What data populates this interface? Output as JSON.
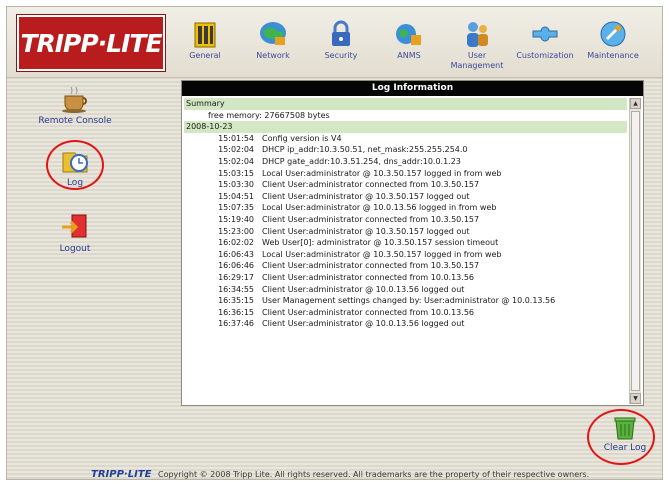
{
  "logo": {
    "text": "TRIPP·LITE"
  },
  "nav": {
    "items": [
      {
        "label": "General",
        "icon": "general-icon"
      },
      {
        "label": "Network",
        "icon": "network-icon"
      },
      {
        "label": "Security",
        "icon": "security-icon"
      },
      {
        "label": "ANMS",
        "icon": "anms-icon"
      },
      {
        "label": "User Management",
        "icon": "user-management-icon"
      },
      {
        "label": "Customization",
        "icon": "customization-icon"
      },
      {
        "label": "Maintenance",
        "icon": "maintenance-icon"
      }
    ]
  },
  "sidebar": {
    "remote_console": "Remote Console",
    "log": "Log",
    "logout": "Logout"
  },
  "log_panel": {
    "title": "Log Information",
    "summary_label": "Summary",
    "free_memory": "free memory: 27667508 bytes",
    "date": "2008-10-23",
    "entries": [
      {
        "time": "15:01:54",
        "message": "Config version is V4"
      },
      {
        "time": "15:02:04",
        "message": "DHCP ip_addr:10.3.50.51, net_mask:255.255.254.0"
      },
      {
        "time": "15:02:04",
        "message": "DHCP gate_addr:10.3.51.254, dns_addr:10.0.1.23"
      },
      {
        "time": "15:03:15",
        "message": "Local User:administrator @ 10.3.50.157 logged in from web"
      },
      {
        "time": "15:03:30",
        "message": "Client User:administrator connected from 10.3.50.157"
      },
      {
        "time": "15:04:51",
        "message": "Client User:administrator @ 10.3.50.157 logged out"
      },
      {
        "time": "15:07:35",
        "message": "Local User:administrator @ 10.0.13.56 logged in from web"
      },
      {
        "time": "15:19:40",
        "message": "Client User:administrator connected from 10.3.50.157"
      },
      {
        "time": "15:23:00",
        "message": "Client User:administrator @ 10.3.50.157 logged out"
      },
      {
        "time": "16:02:02",
        "message": "Web User[0]: administrator @ 10.3.50.157 session timeout"
      },
      {
        "time": "16:06:43",
        "message": "Local User:administrator @ 10.3.50.157 logged in from web"
      },
      {
        "time": "16:06:46",
        "message": "Client User:administrator connected from 10.3.50.157"
      },
      {
        "time": "16:29:17",
        "message": "Client User:administrator connected from 10.0.13.56"
      },
      {
        "time": "16:34:55",
        "message": "Client User:administrator @ 10.0.13.56 logged out"
      },
      {
        "time": "16:35:15",
        "message": "User Management settings changed by: User:administrator @ 10.0.13.56"
      },
      {
        "time": "16:36:15",
        "message": "Client User:administrator connected from 10.0.13.56"
      },
      {
        "time": "16:37:46",
        "message": "Client User:administrator @ 10.0.13.56 logged out"
      }
    ]
  },
  "clear_log": {
    "label": "Clear Log"
  },
  "footer": {
    "logo_text": "TRIPP·LITE",
    "copyright": "Copyright © 2008 Tripp Lite. All rights reserved. All trademarks are the property of their respective owners."
  },
  "colors": {
    "brand_red": "#b91c1c",
    "highlight_circle": "#e01616",
    "summary_bg": "#d2e8c4"
  }
}
